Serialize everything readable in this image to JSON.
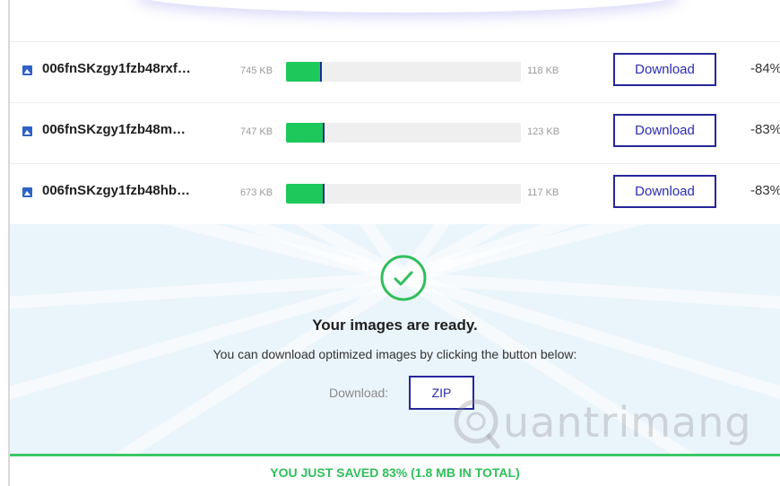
{
  "files": [
    {
      "name": "006fnSKzgy1fzb48rxf…",
      "original_size": "745 KB",
      "new_size": "118 KB",
      "download_label": "Download",
      "saving": "-84%",
      "progress_fill": 0.15
    },
    {
      "name": "006fnSKzgy1fzb48m…",
      "original_size": "747 KB",
      "new_size": "123 KB",
      "download_label": "Download",
      "saving": "-83%",
      "progress_fill": 0.16
    },
    {
      "name": "006fnSKzgy1fzb48hb…",
      "original_size": "673 KB",
      "new_size": "117 KB",
      "download_label": "Download",
      "saving": "-83%",
      "progress_fill": 0.16
    }
  ],
  "ready": {
    "title": "Your images are ready.",
    "description": "You can download optimized images by clicking the button below:",
    "download_label": "Download:",
    "zip_label": "ZIP"
  },
  "summary": "YOU JUST SAVED 83% (1.8 MB IN TOTAL)",
  "watermark": "uantrimang",
  "colors": {
    "accent": "#27279b",
    "progress": "#1ec95c",
    "success": "#2fbf5a",
    "panel_bg": "#eaf4fb"
  },
  "icons": {
    "file": "image-file-icon",
    "ready": "check-circle-icon"
  }
}
